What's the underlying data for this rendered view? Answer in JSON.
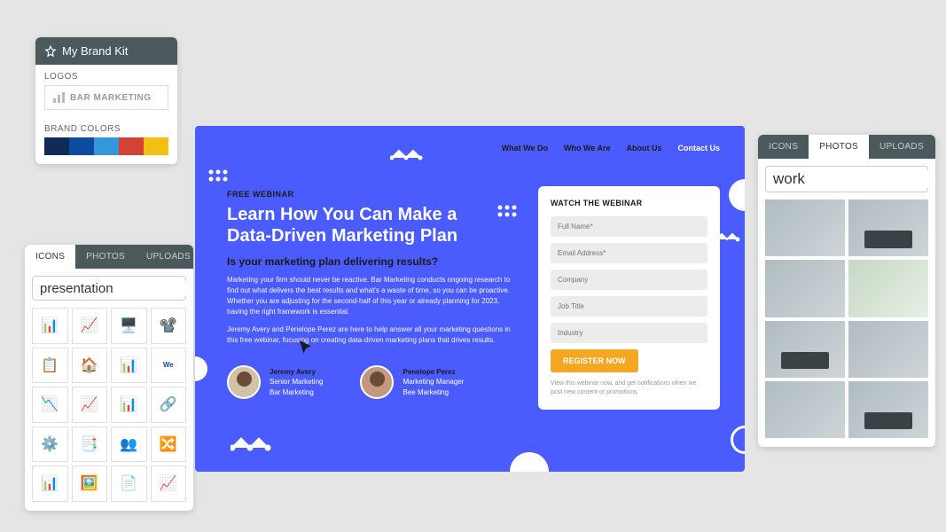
{
  "brandKit": {
    "title": "My Brand Kit",
    "logosLabel": "LOGOS",
    "logoText": "BAR MARKETING",
    "colorsLabel": "BRAND COLORS",
    "colors": [
      "#0f2b56",
      "#0c4da2",
      "#3498db",
      "#d64135",
      "#f3c012"
    ]
  },
  "iconsPanel": {
    "tabs": [
      "ICONS",
      "PHOTOS",
      "UPLOADS"
    ],
    "activeTab": 0,
    "searchValue": "presentation"
  },
  "photosPanel": {
    "tabs": [
      "ICONS",
      "PHOTOS",
      "UPLOADS"
    ],
    "activeTab": 1,
    "searchValue": "work"
  },
  "canvas": {
    "nav": [
      "What We Do",
      "Who We Are",
      "About Us",
      "Contact Us"
    ],
    "navActiveIndex": 3,
    "overline": "FREE WEBINAR",
    "title1": "Learn How You Can Make a",
    "title2": "Data-Driven Marketing Plan",
    "subhead": "Is your marketing plan delivering results?",
    "para1": "Marketing your firm should never be reactive. Bar Marketing conducts ongoing research to find out what delivers the best results and what's a waste of time, so you can be proactive. Whether you are adjusting for the second-half of this year or already planning for 2023, having the right framework is essential.",
    "para2": "Jeremy Avery and Penelope Perez are here to help answer all your marketing questions in this free webinar, focusing on creating data-driven marketing plans that drives results.",
    "speakers": [
      {
        "name": "Jeremy Avery",
        "title": "Senior Marketing",
        "company": "Bar Marketing"
      },
      {
        "name": "Penelope Perez",
        "title": "Marketing Manager",
        "company": "Bee Marketing"
      }
    ],
    "form": {
      "title": "WATCH THE WEBINAR",
      "fields": [
        "Full Name*",
        "Email Address*",
        "Company",
        "Job Title",
        "Industry"
      ],
      "button": "REGISTER NOW",
      "disclaimer": "View this webinar now, and get notifications when we post new content or promotions."
    }
  }
}
